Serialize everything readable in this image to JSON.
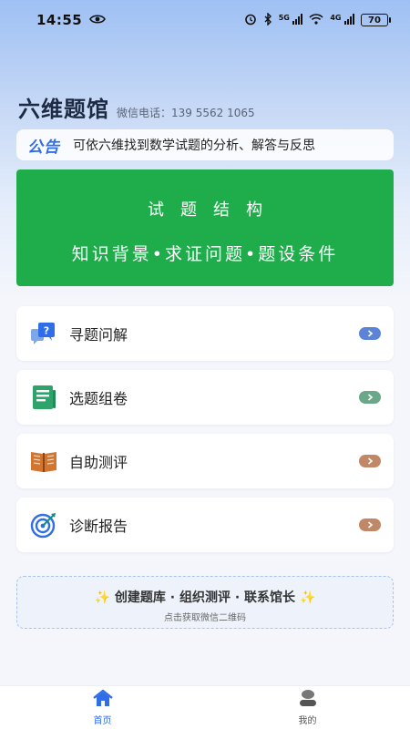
{
  "status_bar": {
    "time": "14:55",
    "signal_1": "5G",
    "signal_2": "4G",
    "battery": "70"
  },
  "header": {
    "title": "六维题馆",
    "phone": "微信电话：139 5562 1065"
  },
  "notice": {
    "badge": "公告",
    "text": "可依六维找到数学试题的分析、解答与反思"
  },
  "banner": {
    "title": "试题结构",
    "subtitle": "知识背景•求证问题•题设条件",
    "color": "#1fad4b"
  },
  "menu": [
    {
      "label": "寻题问解",
      "icon": "question-chat-icon",
      "arrow_color": "#5c84d6"
    },
    {
      "label": "选题组卷",
      "icon": "document-icon",
      "arrow_color": "#6aa889"
    },
    {
      "label": "自助测评",
      "icon": "book-icon",
      "arrow_color": "#c08867"
    },
    {
      "label": "诊断报告",
      "icon": "target-icon",
      "arrow_color": "#c08867"
    }
  ],
  "promo": {
    "sparkle": "✨",
    "main": "创建题库 · 组织测评 · 联系馆长",
    "sub": "点击获取微信二维码"
  },
  "tabs": [
    {
      "label": "首页",
      "icon": "home-icon",
      "active": true
    },
    {
      "label": "我的",
      "icon": "profile-icon",
      "active": false
    }
  ],
  "colors": {
    "accent": "#2f6ee8",
    "banner_green": "#1fad4b"
  }
}
